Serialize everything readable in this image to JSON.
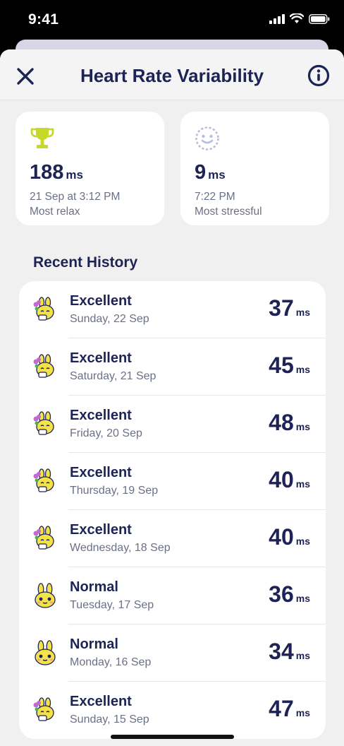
{
  "status_bar": {
    "time": "9:41"
  },
  "header": {
    "title": "Heart Rate Variability"
  },
  "stats": [
    {
      "icon": "trophy-icon",
      "value": "188",
      "unit": "ms",
      "when": "21 Sep at 3:12 PM",
      "caption": "Most relax"
    },
    {
      "icon": "smiley-icon",
      "value": "9",
      "unit": "ms",
      "when": "7:22 PM",
      "caption": "Most stressful"
    }
  ],
  "history": {
    "title": "Recent History",
    "rows": [
      {
        "status": "Excellent",
        "date": "Sunday, 22 Sep",
        "value": "37",
        "unit": "ms",
        "icon": "happy-bunny-icon"
      },
      {
        "status": "Excellent",
        "date": "Saturday, 21 Sep",
        "value": "45",
        "unit": "ms",
        "icon": "happy-bunny-icon"
      },
      {
        "status": "Excellent",
        "date": "Friday, 20 Sep",
        "value": "48",
        "unit": "ms",
        "icon": "happy-bunny-icon"
      },
      {
        "status": "Excellent",
        "date": "Thursday, 19 Sep",
        "value": "40",
        "unit": "ms",
        "icon": "happy-bunny-icon"
      },
      {
        "status": "Excellent",
        "date": "Wednesday, 18 Sep",
        "value": "40",
        "unit": "ms",
        "icon": "happy-bunny-icon"
      },
      {
        "status": "Normal",
        "date": "Tuesday, 17 Sep",
        "value": "36",
        "unit": "ms",
        "icon": "normal-bunny-icon"
      },
      {
        "status": "Normal",
        "date": "Monday, 16 Sep",
        "value": "34",
        "unit": "ms",
        "icon": "normal-bunny-icon"
      },
      {
        "status": "Excellent",
        "date": "Sunday, 15 Sep",
        "value": "47",
        "unit": "ms",
        "icon": "happy-bunny-icon"
      }
    ]
  },
  "colors": {
    "accent": "#1d2455",
    "trophy": "#c6d82a",
    "bunny": "#f4e24a",
    "flower": "#c36ad0",
    "background": "#f0f0f0"
  }
}
